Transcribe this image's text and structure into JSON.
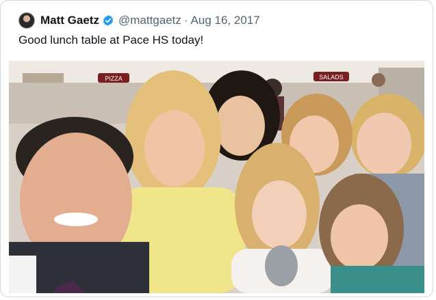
{
  "tweet": {
    "author_name": "Matt Gaetz",
    "handle": "@mattgaetz",
    "separator": "·",
    "date": "Aug 16, 2017",
    "text": "Good lunch table at Pace HS today!",
    "avatar_icon": "profile-photo",
    "verified_icon": "verified-badge-icon",
    "verified_color": "#1d9bf0"
  },
  "photo": {
    "description_icon": "group-selfie-photo",
    "wall_signs": [
      "PIZZA",
      "SALADS"
    ]
  }
}
